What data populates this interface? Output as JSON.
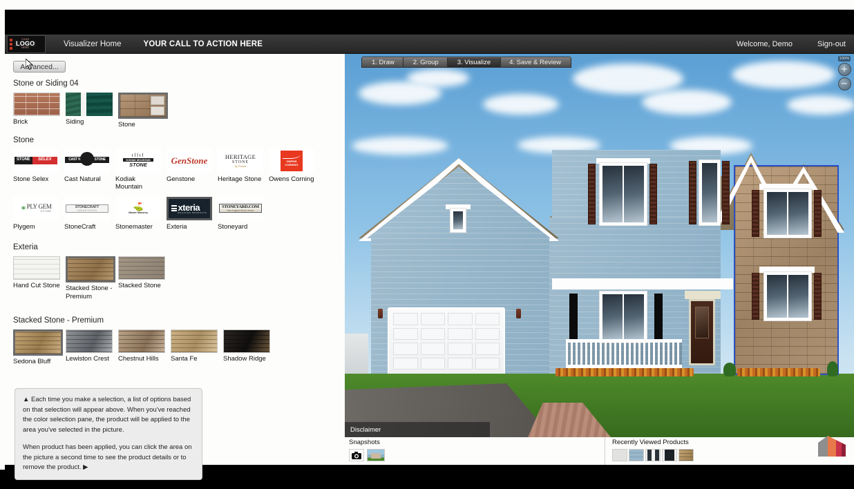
{
  "header": {
    "logo": {
      "line1": "YOUR",
      "line2": "LOGO",
      "line3": "HERE",
      "icon": "logo-mark"
    },
    "home_link": "Visualizer Home",
    "cta": "YOUR CALL TO ACTION HERE",
    "welcome": "Welcome, Demo",
    "signout": "Sign-out"
  },
  "sidebar": {
    "advanced_button": "Advanced...",
    "groups": [
      {
        "title": "Stone or Siding 04",
        "items": [
          {
            "label": "Brick",
            "texture": "tx-brick",
            "selected": false
          },
          {
            "label": "Siding",
            "texture": "tx-siding",
            "selected": false
          },
          {
            "label": "Stone",
            "texture": "tx-stone",
            "selected": true
          }
        ]
      }
    ],
    "stone_group_title": "Stone",
    "brands": [
      {
        "label": "Stone Selex",
        "selected": false
      },
      {
        "label": "Cast Natural",
        "selected": false
      },
      {
        "label": "Kodiak Mountain",
        "selected": false
      },
      {
        "label": "Genstone",
        "selected": false
      },
      {
        "label": "Heritage Stone",
        "selected": false
      },
      {
        "label": "Owens Corning",
        "selected": false
      },
      {
        "label": "Plygem",
        "selected": false
      },
      {
        "label": "StoneCraft",
        "selected": false
      },
      {
        "label": "Stonemaster",
        "selected": false
      },
      {
        "label": "Exteria",
        "selected": true
      },
      {
        "label": "Stoneyard",
        "selected": false
      }
    ],
    "brand_logos": {
      "stone_selex_1": "STONE",
      "stone_selex_2": "SELEX",
      "cast_natural": "CAST NATURAL STONE",
      "kodiak_1": "KODIAK MOUNTAIN",
      "kodiak_2": "STONE",
      "genstone": "GenStone",
      "heritage_1": "HERITAGE",
      "heritage_2": "STONE",
      "heritage_3": "by Provia",
      "owens_1": "OWENS",
      "owens_2": "CORNING",
      "plygem_1": "PLY GEM",
      "plygem_2": "STONE",
      "stonecraft_1": "STONECRAFT",
      "stonecraft_2": "INDUSTRIES",
      "stonemaster": "Master Masonry",
      "exteria_1": "xteria",
      "exteria_2": "BUILDING PRODUCTS",
      "stoneyard_1": "STONEYARD.COM",
      "stoneyard_2": "New England Stone Veneer"
    },
    "exteria_group_title": "Exteria",
    "exteria_products": [
      {
        "label": "Hand Cut Stone",
        "texture": "tx-handcut",
        "selected": false
      },
      {
        "label": "Stacked Stone - Premium",
        "texture": "tx-stackprem",
        "selected": true
      },
      {
        "label": "Stacked Stone",
        "texture": "tx-stack",
        "selected": false
      }
    ],
    "color_group_title": "Stacked Stone - Premium",
    "colors": [
      {
        "label": "Sedona Bluff",
        "texture": "tx-sedona",
        "selected": true
      },
      {
        "label": "Lewiston Crest",
        "texture": "tx-lewiston",
        "selected": false
      },
      {
        "label": "Chestnut Hills",
        "texture": "tx-chestnut",
        "selected": false
      },
      {
        "label": "Santa Fe",
        "texture": "tx-santafe",
        "selected": false
      },
      {
        "label": "Shadow Ridge",
        "texture": "tx-shadow",
        "selected": false
      }
    ],
    "help": {
      "paragraph1": "▲ Each time you make a selection, a list of options based on that selection will appear above. When you've reached the color selection pane, the product will be applied to the area you've selected in the picture.",
      "paragraph2": "When product has been applied, you can click the area on the picture a second time to see the product details or to remove the product. ▶"
    }
  },
  "visualizer": {
    "steps": [
      {
        "label": "1. Draw",
        "active": false
      },
      {
        "label": "2. Group",
        "active": false
      },
      {
        "label": "3. Visualize",
        "active": true
      },
      {
        "label": "4. Save & Review",
        "active": false
      }
    ],
    "zoom": {
      "percent": "100%",
      "zoom_in": "+",
      "zoom_out": "−"
    },
    "disclaimer": "Disclaimer",
    "selection_color": "#2b4fc4",
    "house": {
      "siding_color": "#9fbbcd",
      "roof_color": "#8b7c5f",
      "stone_color": "#ae9374",
      "trim_color": "#fdfdfd",
      "shutter_color": "#42201f",
      "door_color": "#331a10",
      "lawn_color": "#3f7722",
      "sky_color": "#8fc3e6"
    }
  },
  "bottombar": {
    "snapshots_title": "Snapshots",
    "camera_icon": "camera-icon",
    "recent_title": "Recently Viewed Products",
    "recent_items": [
      "swatch-white",
      "swatch-blue-siding",
      "swatch-window-pair",
      "swatch-dark-window",
      "swatch-stone"
    ]
  }
}
